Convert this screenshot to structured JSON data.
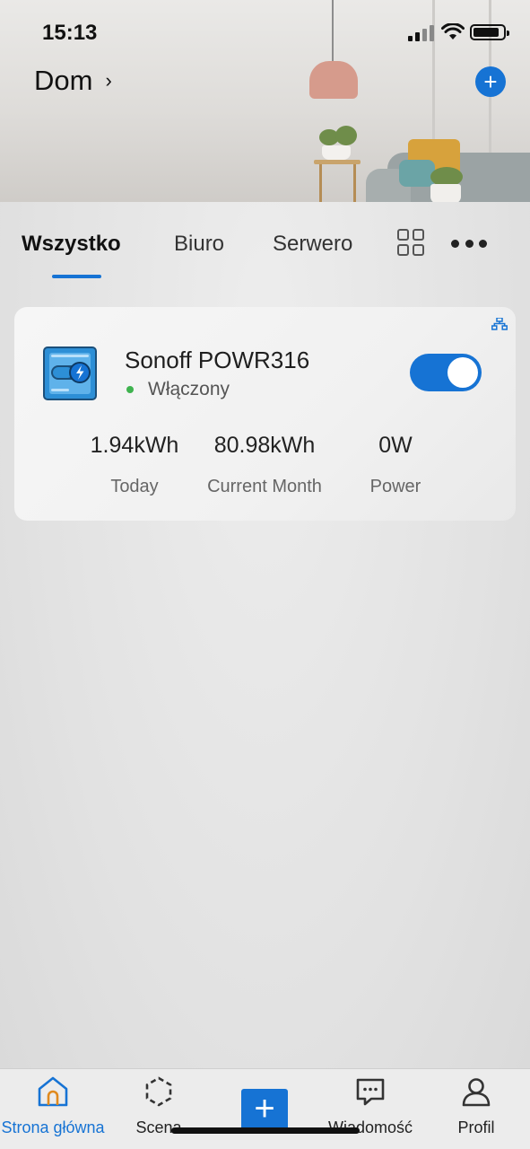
{
  "status_bar": {
    "time": "15:13"
  },
  "header": {
    "home_name": "Dom",
    "chevron": "›",
    "add_icon": "plus-icon"
  },
  "tabs": [
    {
      "label": "Wszystko",
      "active": true
    },
    {
      "label": "Biuro",
      "active": false
    },
    {
      "label": "Serwerownia",
      "active": false
    }
  ],
  "device": {
    "name": "Sonoff POWR316",
    "state": "Włączony",
    "switch_on": true,
    "stats": [
      {
        "value": "1.94kWh",
        "label": "Today"
      },
      {
        "value": "80.98kWh",
        "label": "Current Month"
      },
      {
        "value": "0W",
        "label": "Power"
      }
    ]
  },
  "bottom_nav": [
    {
      "label": "Strona główna",
      "icon": "home-icon",
      "active": true
    },
    {
      "label": "Scena",
      "icon": "scene-icon",
      "active": false
    },
    {
      "label": "",
      "icon": "plus-icon",
      "active": false
    },
    {
      "label": "Wiadomość",
      "icon": "message-icon",
      "active": false
    },
    {
      "label": "Profil",
      "icon": "profile-icon",
      "active": false
    }
  ],
  "colors": {
    "accent": "#1673d4",
    "online": "#3fb34f"
  }
}
